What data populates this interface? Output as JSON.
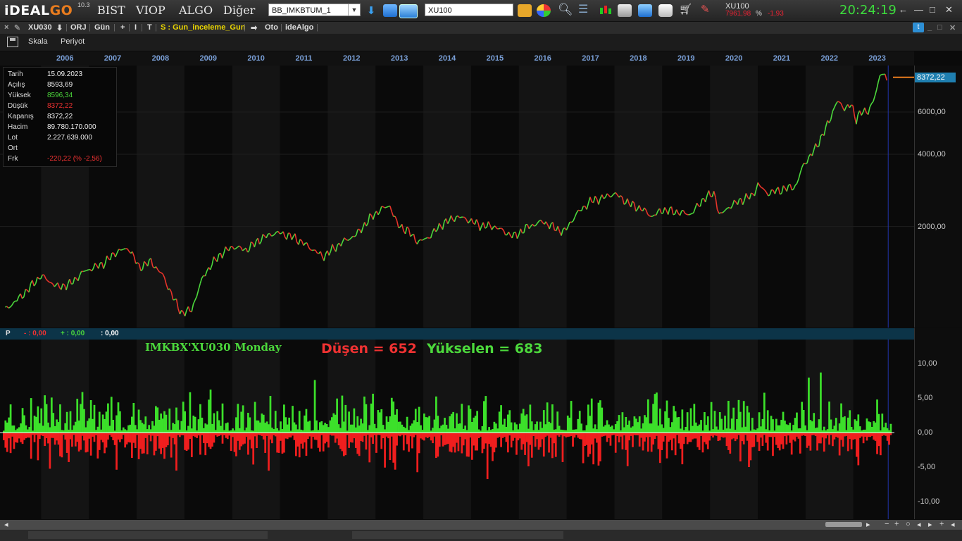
{
  "app": {
    "logo_main": "iDEAL",
    "logo_accent": "GO",
    "version": "10.3",
    "menu": [
      "BIST",
      "VIOP",
      "ALGO",
      "Diğer"
    ],
    "list_select": "BB_IMKBTUM_1",
    "symbol_input": "XU100",
    "ticker": {
      "name": "XU100",
      "value": "7961,98",
      "pct_symbol": "%",
      "change": "-1,93"
    },
    "clock": "20:24:19",
    "window_buttons": [
      "←",
      "—",
      "□",
      "✕"
    ],
    "colors": {
      "up": "#4cd93c",
      "down": "#f03232",
      "accent": "#e97c1e",
      "clock": "#3ddc3d"
    }
  },
  "chart_toolbar": {
    "close": "×",
    "symbol": "XU030",
    "down_arrow": "⬇",
    "orj": "ORJ",
    "period": "Gün",
    "plus": "+",
    "i_btn": "I",
    "t_btn": "T",
    "strategy": "S : Gun_inceleme_Gun",
    "arrow": "➡",
    "oto": "Oto",
    "idealgo": "ideAlgo",
    "window_buttons": [
      "_",
      "□",
      "✕"
    ]
  },
  "chart_sub": {
    "scale": "Skala",
    "period": "Periyot"
  },
  "years": [
    "2006",
    "2007",
    "2008",
    "2009",
    "2010",
    "2011",
    "2012",
    "2013",
    "2014",
    "2015",
    "2016",
    "2017",
    "2018",
    "2019",
    "2020",
    "2021",
    "2022",
    "2023"
  ],
  "price_axis": [
    "6000,00",
    "4000,00",
    "2000,00"
  ],
  "last_price": "8372,22",
  "info": {
    "rows": [
      {
        "label": "Tarih",
        "value": "15.09.2023",
        "cls": ""
      },
      {
        "label": "Açılış",
        "value": "8593,69",
        "cls": ""
      },
      {
        "label": "Yüksek",
        "value": "8596,34",
        "cls": "green"
      },
      {
        "label": "Düşük",
        "value": "8372,22",
        "cls": "red"
      },
      {
        "label": "Kapanış",
        "value": "8372,22",
        "cls": ""
      },
      {
        "label": "Hacim",
        "value": "89.780.170.000",
        "cls": ""
      },
      {
        "label": "Lot",
        "value": "2.227.639.000",
        "cls": ""
      },
      {
        "label": "Ort",
        "value": "",
        "cls": ""
      },
      {
        "label": "Frk",
        "value": "-220,22 (% -2,56)",
        "cls": "red"
      }
    ]
  },
  "indicator": {
    "p_label": "P",
    "minus_label": "- : 0,00",
    "plus_label": "+ : 0,00",
    "colon_label": ": 0,00",
    "title": "IMKBX'XU030",
    "day": "Monday",
    "down_text": "Düşen = 652",
    "up_text": "Yükselen = 683",
    "axis": [
      "10,00",
      "5,00",
      "0,00",
      "-5,00",
      "-10,00"
    ]
  },
  "chart_data": [
    {
      "type": "line",
      "title": "XU030",
      "y_scale": "log",
      "x_range": [
        2005.2,
        2023.8
      ],
      "ylim": [
        780,
        9000
      ],
      "yticks": [
        2000,
        4000,
        6000
      ],
      "x": [
        2005.25,
        2005.6,
        2006.0,
        2006.35,
        2006.6,
        2006.9,
        2007.3,
        2007.6,
        2007.85,
        2008.05,
        2008.3,
        2008.55,
        2008.8,
        2008.95,
        2009.15,
        2009.4,
        2009.7,
        2010.0,
        2010.3,
        2010.6,
        2010.85,
        2011.0,
        2011.3,
        2011.6,
        2011.9,
        2012.0,
        2012.3,
        2012.6,
        2012.9,
        2013.1,
        2013.3,
        2013.45,
        2013.7,
        2013.9,
        2014.1,
        2014.4,
        2014.7,
        2014.9,
        2015.2,
        2015.5,
        2015.7,
        2015.9,
        2016.2,
        2016.5,
        2016.8,
        2016.95,
        2017.2,
        2017.5,
        2017.8,
        2018.0,
        2018.3,
        2018.6,
        2018.8,
        2019.0,
        2019.3,
        2019.6,
        2019.9,
        2020.1,
        2020.2,
        2020.35,
        2020.6,
        2020.9,
        2021.0,
        2021.2,
        2021.5,
        2021.8,
        2021.95,
        2022.2,
        2022.5,
        2022.65,
        2022.8,
        2022.95,
        2023.05,
        2023.15,
        2023.3,
        2023.5,
        2023.58,
        2023.7
      ],
      "y": [
        900,
        1030,
        1250,
        1120,
        1150,
        1300,
        1400,
        1580,
        1620,
        1350,
        1430,
        1250,
        980,
        870,
        900,
        1250,
        1500,
        1650,
        1600,
        1780,
        1870,
        1880,
        1800,
        1650,
        1500,
        1550,
        1720,
        1850,
        2180,
        2350,
        2450,
        2050,
        1900,
        1720,
        1800,
        2050,
        2200,
        2150,
        2020,
        2000,
        1900,
        1820,
        2000,
        2100,
        1950,
        1900,
        2250,
        2550,
        2650,
        2750,
        2500,
        2350,
        2200,
        2350,
        2300,
        2250,
        2650,
        2750,
        2200,
        2380,
        2550,
        2700,
        3000,
        2750,
        2850,
        2950,
        3600,
        4200,
        5500,
        6700,
        6200,
        6500,
        5500,
        6100,
        5900,
        7500,
        8800,
        8372.22
      ]
    },
    {
      "type": "bar",
      "title": "IMKBX'XU030 Monday",
      "series": [
        {
          "name": "Yükselen",
          "count": 683
        },
        {
          "name": "Düşen",
          "count": 652
        }
      ],
      "ylim": [
        -12.5,
        13.5
      ],
      "yticks": [
        10,
        5,
        0,
        -5,
        -10
      ]
    }
  ]
}
